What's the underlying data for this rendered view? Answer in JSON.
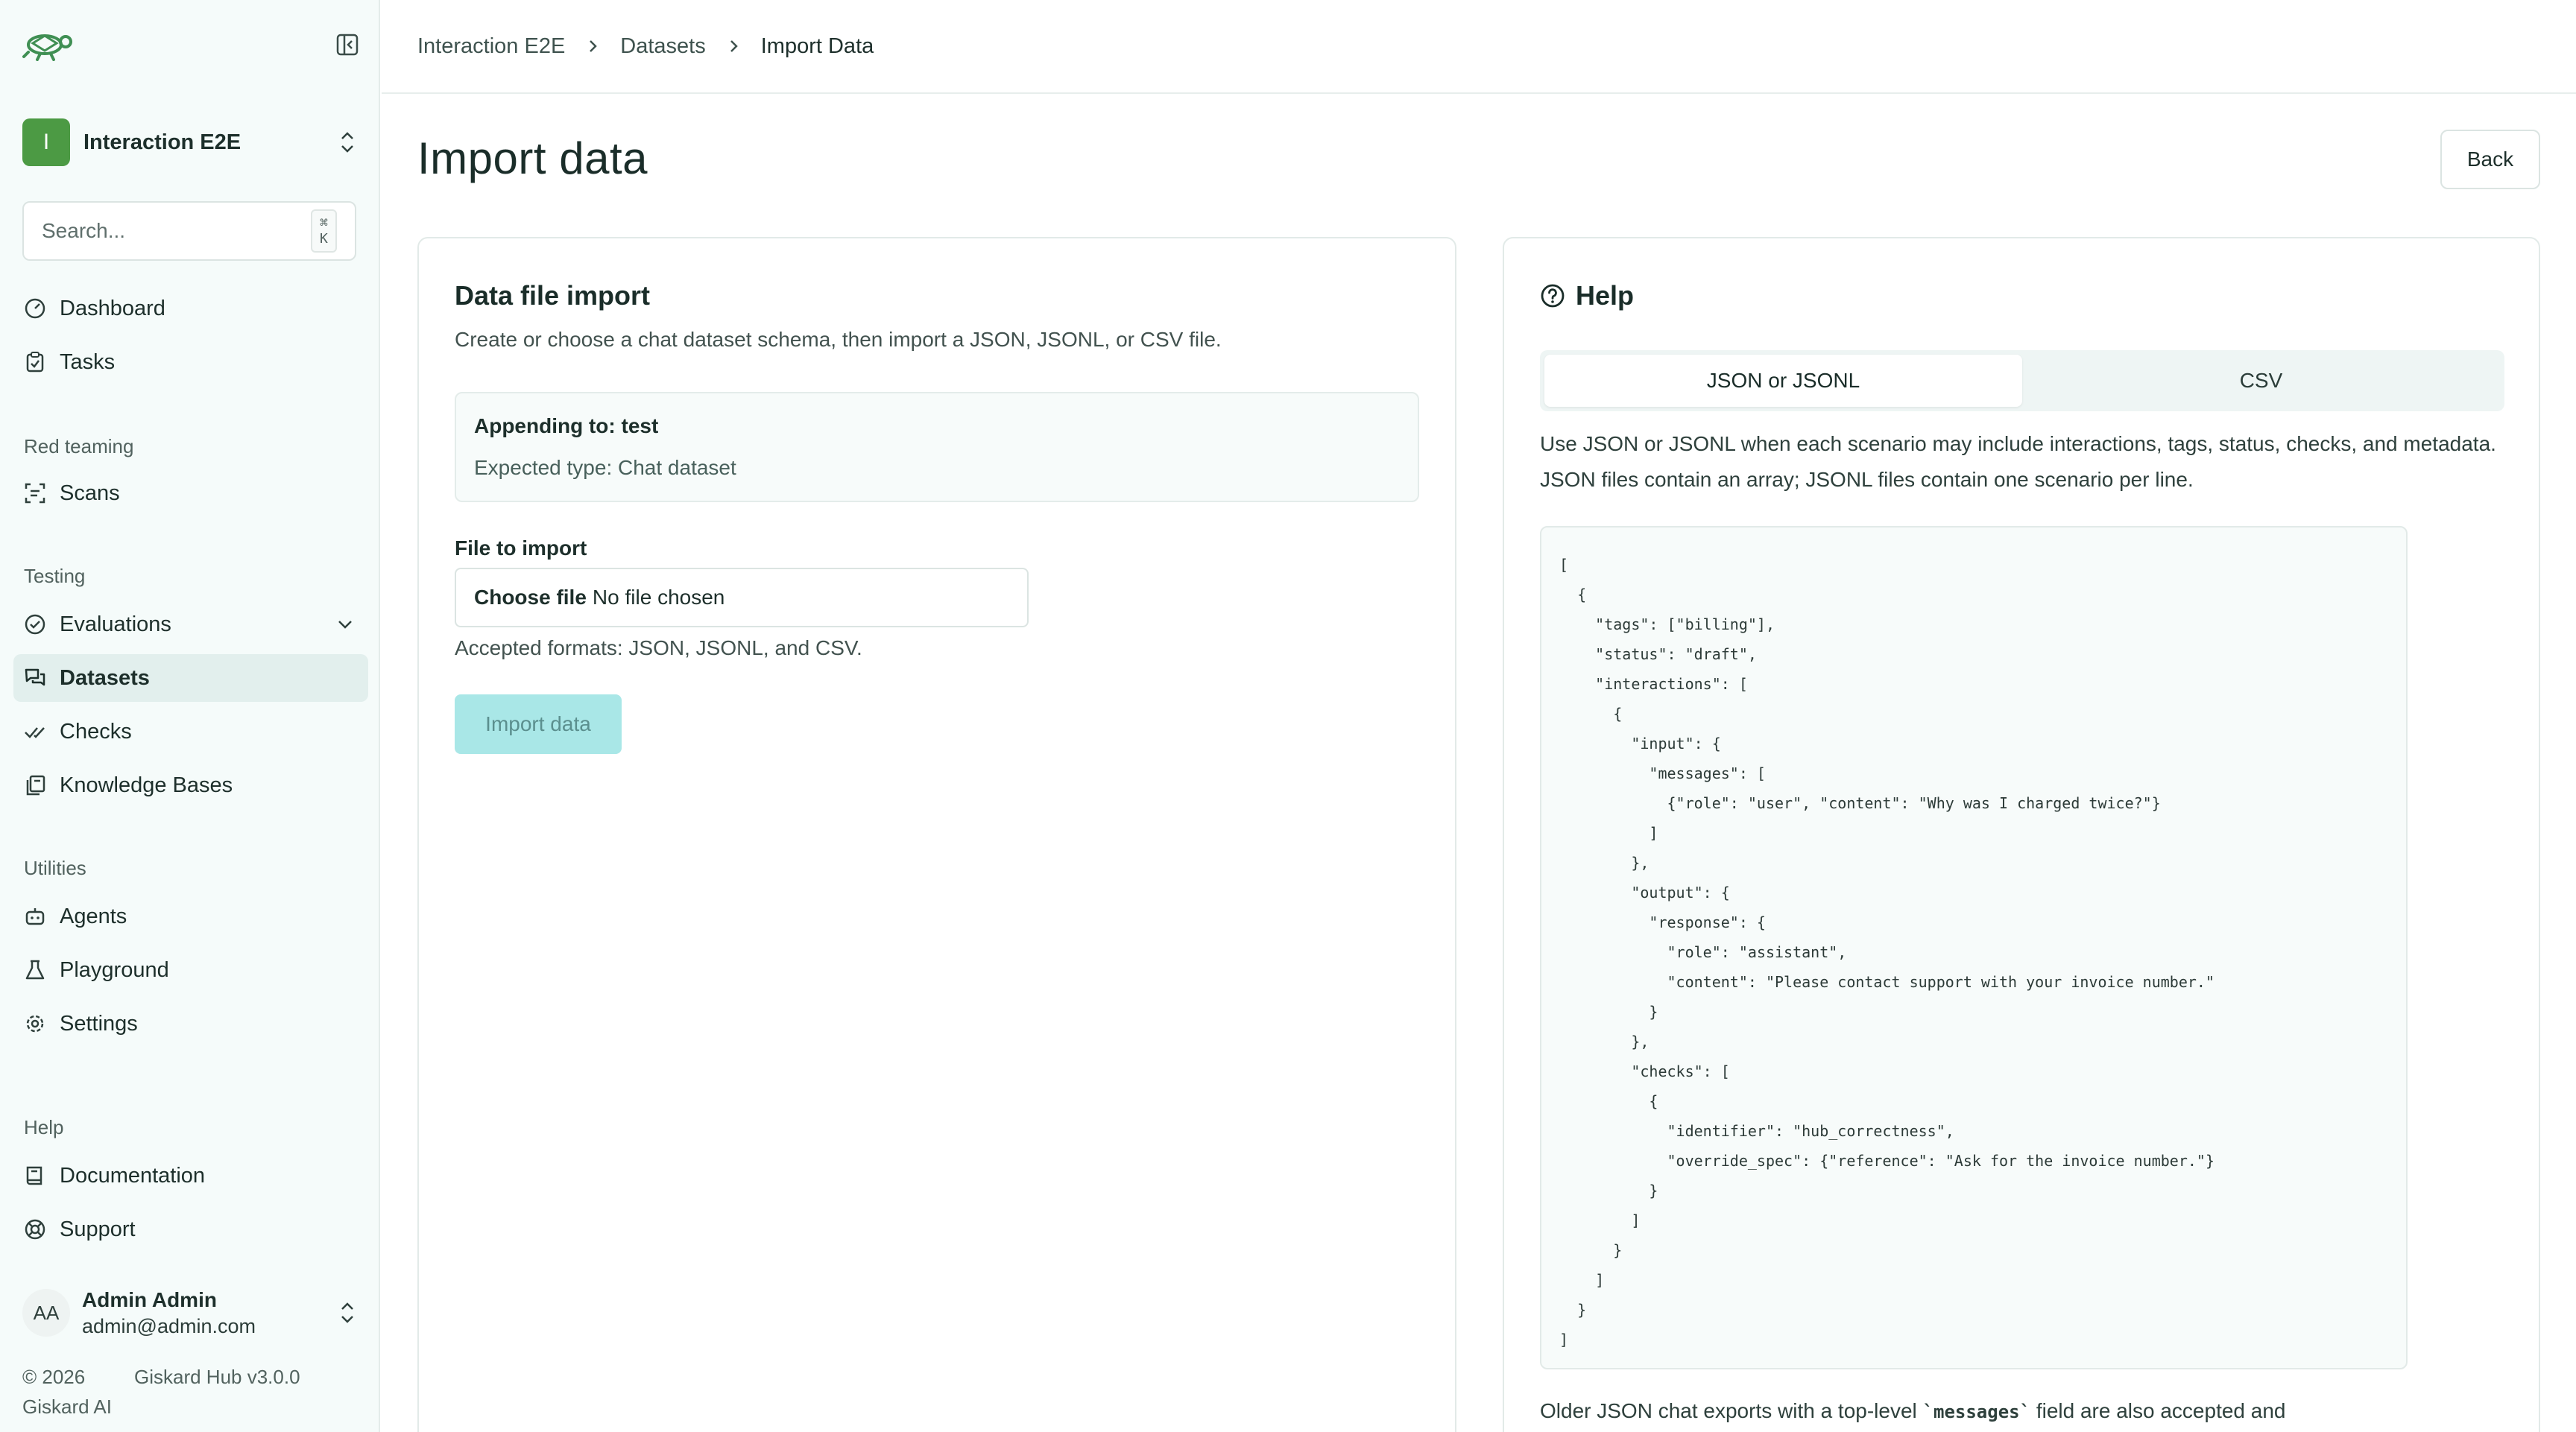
{
  "sidebar": {
    "project": {
      "initial": "I",
      "name": "Interaction E2E"
    },
    "search": {
      "placeholder": "Search...",
      "shortcut": "⌘ K"
    },
    "items": {
      "dashboard": "Dashboard",
      "tasks": "Tasks",
      "scans": "Scans",
      "evaluations": "Evaluations",
      "datasets": "Datasets",
      "checks": "Checks",
      "knowledge_bases": "Knowledge Bases",
      "agents": "Agents",
      "playground": "Playground",
      "settings": "Settings",
      "documentation": "Documentation",
      "support": "Support"
    },
    "groups": {
      "red_teaming": "Red teaming",
      "testing": "Testing",
      "utilities": "Utilities",
      "help": "Help"
    },
    "user": {
      "initials": "AA",
      "name": "Admin Admin",
      "email": "admin@admin.com"
    },
    "footer": {
      "copyright": "© 2026",
      "company": "Giskard AI",
      "version": "Giskard Hub v3.0.0"
    }
  },
  "breadcrumb": [
    "Interaction E2E",
    "Datasets",
    "Import Data"
  ],
  "page": {
    "title": "Import data",
    "back_label": "Back"
  },
  "import_card": {
    "title": "Data file import",
    "description": "Create or choose a chat dataset schema, then import a JSON, JSONL, or CSV file.",
    "append_title": "Appending to: test",
    "append_type": "Expected type: Chat dataset",
    "file_label": "File to import",
    "choose_file": "Choose file",
    "no_file": "No file chosen",
    "formats": "Accepted formats: JSON, JSONL, and CSV.",
    "import_label": "Import data"
  },
  "help_card": {
    "title": "Help",
    "tabs": [
      "JSON or JSONL",
      "CSV"
    ],
    "description": "Use JSON or JSONL when each scenario may include interactions, tags, status, checks, and metadata. JSON files contain an array; JSONL files contain one scenario per line.",
    "code": "[\n  {\n    \"tags\": [\"billing\"],\n    \"status\": \"draft\",\n    \"interactions\": [\n      {\n        \"input\": {\n          \"messages\": [\n            {\"role\": \"user\", \"content\": \"Why was I charged twice?\"}\n          ]\n        },\n        \"output\": {\n          \"response\": {\n            \"role\": \"assistant\",\n            \"content\": \"Please contact support with your invoice number.\"\n          }\n        },\n        \"checks\": [\n          {\n            \"identifier\": \"hub_correctness\",\n            \"override_spec\": {\"reference\": \"Ask for the invoice number.\"}\n          }\n        ]\n      }\n    ]\n  }\n]",
    "note_before": "Older JSON chat exports with a top-level ",
    "note_code": "`messages`",
    "note_after": " field are also accepted and"
  },
  "colors": {
    "accent": "#4c9a44",
    "active_nav": "#e2efed",
    "import_button": "#a9e7e7"
  }
}
